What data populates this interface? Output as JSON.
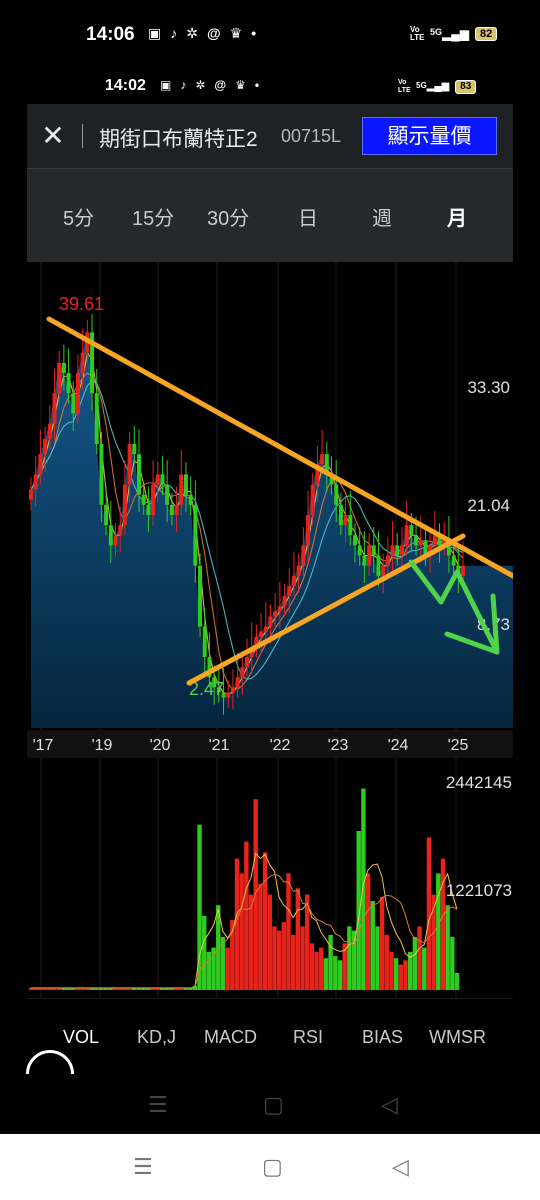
{
  "status_bar_outer": {
    "time": "14:06",
    "notification_icons": [
      "message-icon",
      "tiktok-icon",
      "app-icon",
      "threads-icon",
      "crown-icon",
      "dot-icon"
    ],
    "network": "5G",
    "volte": "Vo LTE",
    "battery": "82"
  },
  "status_bar_inner": {
    "time": "14:02",
    "notification_icons": [
      "message-icon",
      "tiktok-icon",
      "app-icon",
      "threads-icon",
      "crown-icon",
      "dot-icon"
    ],
    "network": "5G",
    "volte": "Vo LTE",
    "battery": "83"
  },
  "header": {
    "close_icon": "close-icon",
    "name": "期街口布蘭特正2",
    "code": "00715L",
    "show_price_button": "顯示量價"
  },
  "periods": [
    {
      "label": "5分",
      "active": false
    },
    {
      "label": "15分",
      "active": false
    },
    {
      "label": "30分",
      "active": false
    },
    {
      "label": "日",
      "active": false
    },
    {
      "label": "週",
      "active": false
    },
    {
      "label": "月",
      "active": true
    }
  ],
  "chart_data": [
    {
      "type": "candlestick",
      "period": "monthly",
      "x_labels": [
        "'17",
        "'19",
        "'20",
        "'21",
        "'22",
        "'23",
        "'24",
        "'25"
      ],
      "y_axis_labels": [
        "33.30",
        "21.04",
        "8.73"
      ],
      "high_annotation": "39.61",
      "low_annotation": "2.47",
      "ylim": [
        0,
        42
      ],
      "up_color": "#e8231c",
      "down_color": "#2ecc1f",
      "area_fill": "#0e4a78",
      "closes": [
        23.5,
        25,
        27,
        28.5,
        30,
        33,
        36,
        35,
        33,
        31,
        35,
        37,
        39,
        33,
        28,
        22,
        20,
        18,
        19,
        20,
        24,
        28,
        27,
        23,
        22,
        21,
        24,
        25,
        24,
        22,
        21,
        22,
        25,
        23,
        22,
        16,
        10,
        7,
        5,
        4,
        3.5,
        3,
        3.5,
        4,
        5,
        6,
        7,
        8,
        9,
        9.5,
        10,
        11,
        11.5,
        12,
        13,
        14,
        15,
        16,
        18,
        21,
        24,
        26,
        27,
        25,
        24,
        22,
        20,
        21,
        19,
        18,
        17,
        16,
        18,
        17,
        15,
        16,
        17,
        18,
        17,
        18,
        20,
        19,
        18,
        18.5,
        17,
        18,
        19,
        18,
        18.5,
        17,
        16,
        15,
        16
      ],
      "trend_lines": [
        {
          "color": "#f6a623",
          "from": [
            0.05,
            39.61
          ],
          "to": [
            1.0,
            15
          ]
        },
        {
          "color": "#f6a623",
          "from": [
            0.33,
            2.47
          ],
          "to": [
            0.88,
            19.5
          ]
        }
      ],
      "forecast_arrow_color": "#4fd34a",
      "ma_colors": [
        "#f2c14e",
        "#d97a3a",
        "#58c3c8"
      ]
    },
    {
      "type": "bar",
      "name": "VOL",
      "y_axis_labels": [
        "2442145",
        "1221073"
      ],
      "ylim": [
        0,
        2442145
      ],
      "values": [
        0.01,
        0.01,
        0.01,
        0.01,
        0.01,
        0.01,
        0.01,
        0.01,
        0.01,
        0.01,
        0.01,
        0.01,
        0.01,
        0.01,
        0.01,
        0.01,
        0.01,
        0.01,
        0.01,
        0.01,
        0.01,
        0.01,
        0.01,
        0.01,
        0.01,
        0.01,
        0.01,
        0.01,
        0.01,
        0.01,
        0.01,
        0.01,
        0.01,
        0.01,
        0.01,
        0.02,
        0.78,
        0.35,
        0.18,
        0.2,
        0.4,
        0.25,
        0.2,
        0.33,
        0.62,
        0.55,
        0.7,
        0.45,
        0.9,
        0.5,
        0.65,
        0.45,
        0.3,
        0.28,
        0.32,
        0.55,
        0.26,
        0.48,
        0.3,
        0.45,
        0.22,
        0.18,
        0.2,
        0.15,
        0.26,
        0.16,
        0.14,
        0.22,
        0.3,
        0.28,
        0.75,
        0.95,
        0.55,
        0.42,
        0.3,
        0.44,
        0.26,
        0.18,
        0.15,
        0.12,
        0.14,
        0.18,
        0.25,
        0.3,
        0.2,
        0.72,
        0.45,
        0.55,
        0.62,
        0.4,
        0.25,
        0.08
      ],
      "up_color": "#e8231c",
      "down_color": "#2ecc1f"
    }
  ],
  "indicators": [
    {
      "label": "VOL",
      "active": true
    },
    {
      "label": "KD,J",
      "active": false
    },
    {
      "label": "MACD",
      "active": false
    },
    {
      "label": "RSI",
      "active": false
    },
    {
      "label": "BIAS",
      "active": false
    },
    {
      "label": "WMSR",
      "active": false
    }
  ],
  "nav": {
    "menu_icon": "menu-icon",
    "home_icon": "home-icon",
    "back_icon": "back-icon"
  }
}
